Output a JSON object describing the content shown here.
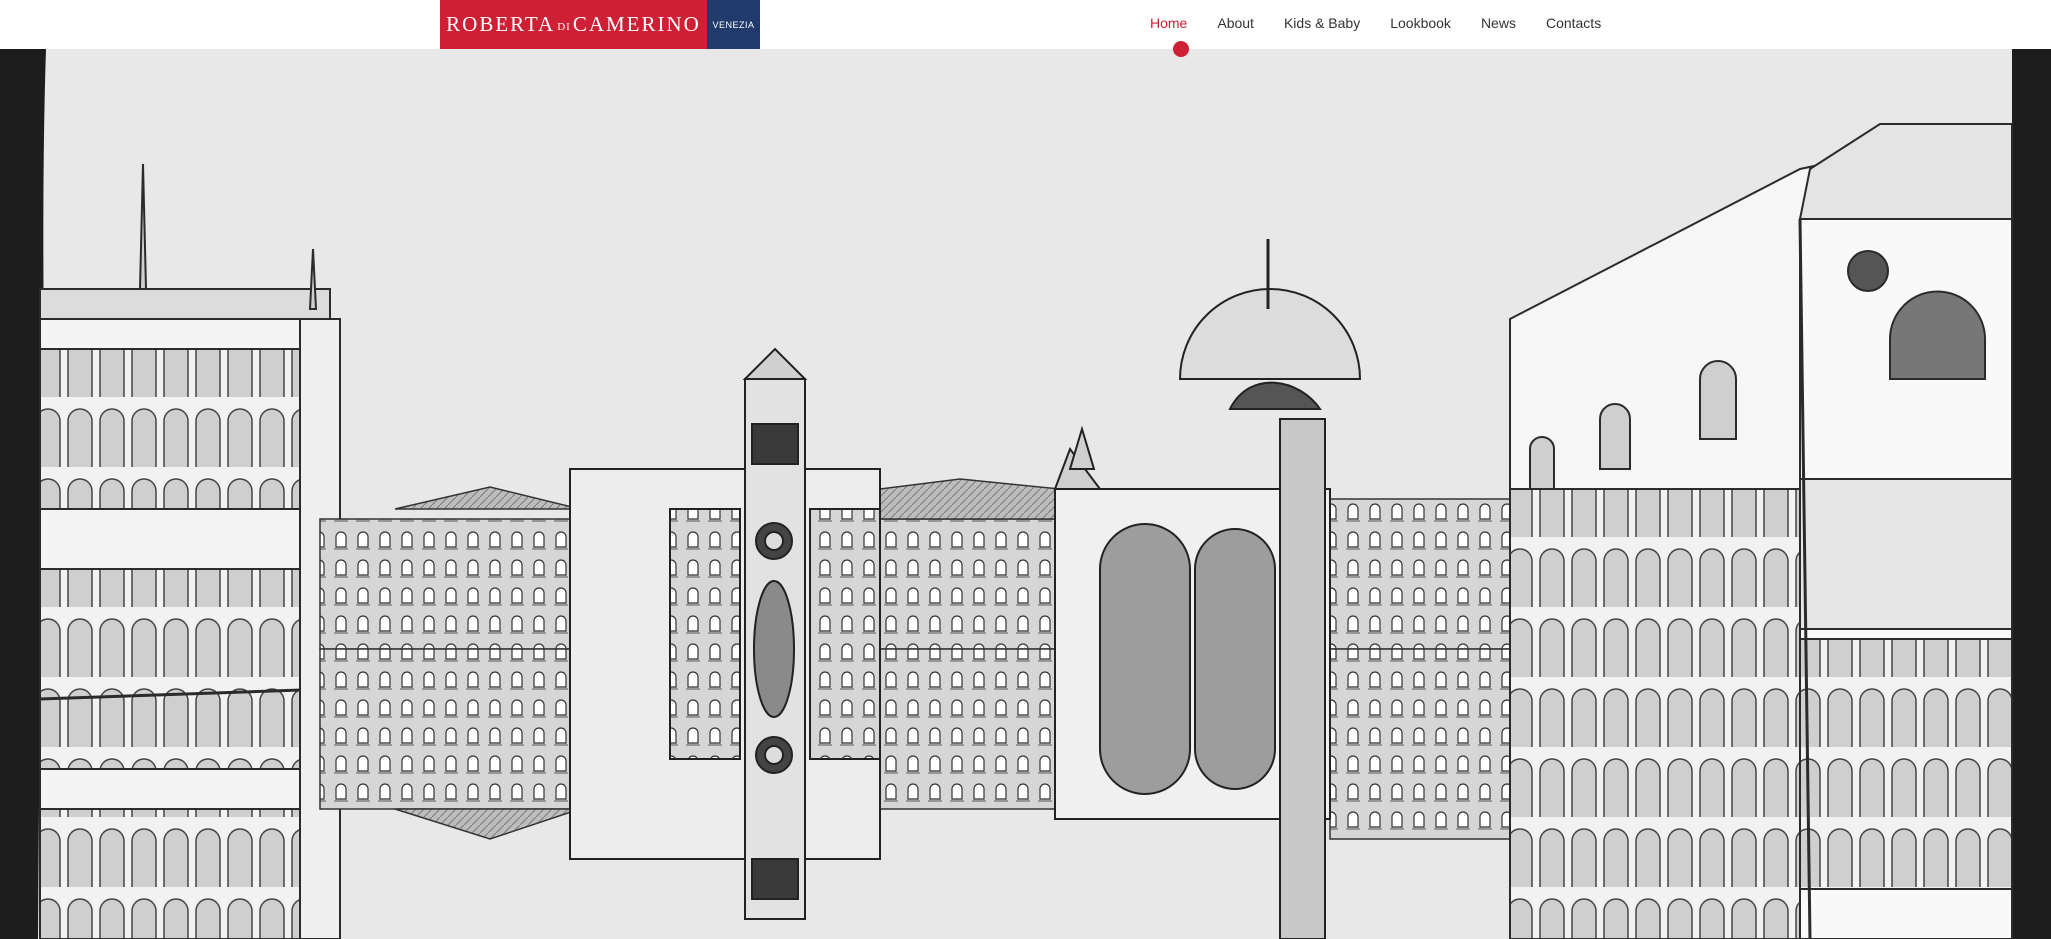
{
  "brand": {
    "name_part1": "ROBERTA",
    "name_small": "DI",
    "name_part2": "CAMERINO",
    "city": "VENEZIA",
    "primary_color": "#cf1f35",
    "secondary_color": "#1f3a6b"
  },
  "nav": {
    "items": [
      {
        "label": "Home",
        "active": true
      },
      {
        "label": "About",
        "active": false
      },
      {
        "label": "Kids & Baby",
        "active": false
      },
      {
        "label": "Lookbook",
        "active": false
      },
      {
        "label": "News",
        "active": false
      },
      {
        "label": "Contacts",
        "active": false
      }
    ]
  },
  "hero": {
    "image_alt": "Illustrated sketch of Piazza San Marco, Venice",
    "icon": "venice-illustration"
  }
}
